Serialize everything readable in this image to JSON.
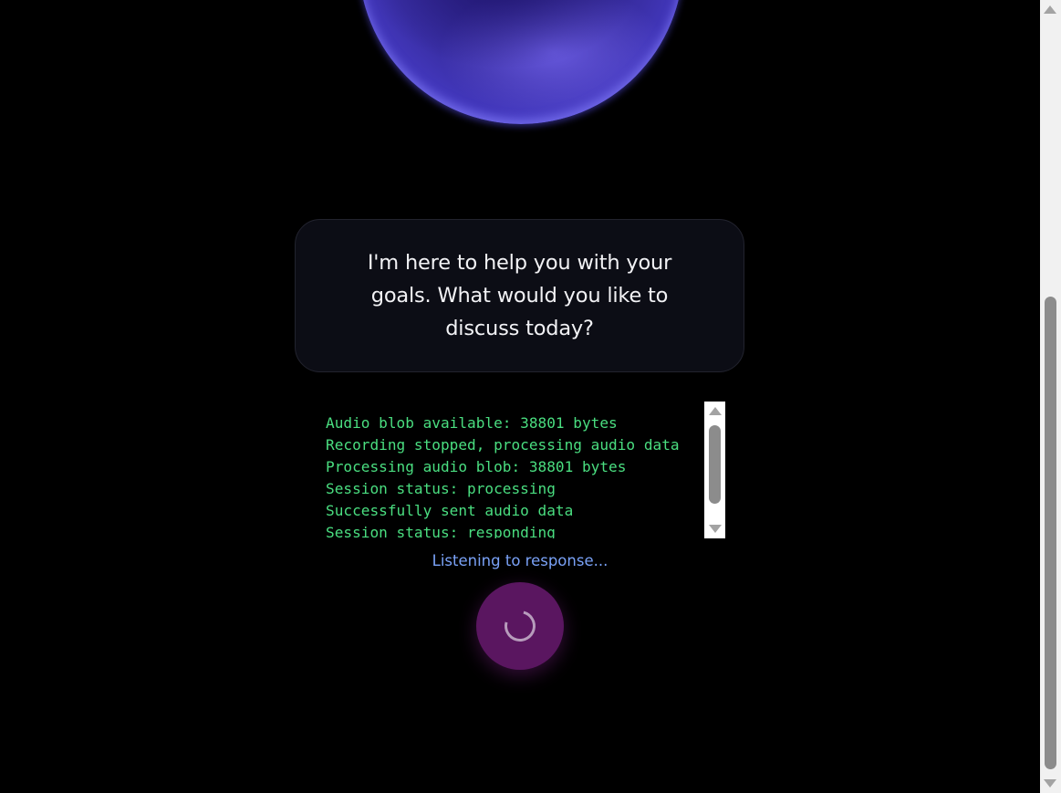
{
  "assistant": {
    "message": "I'm here to help you with your goals. What would you like to discuss today?"
  },
  "debug_log": {
    "lines": [
      "Audio blob available: 38801 bytes",
      "Recording stopped, processing audio data",
      "Processing audio blob: 38801 bytes",
      "Session status: processing",
      "Successfully sent audio data",
      "Session status: responding"
    ]
  },
  "status": {
    "text": "Listening to response..."
  },
  "mic_button": {
    "icon": "loading-spinner-icon",
    "accent_color": "#5a1660"
  },
  "theme": {
    "background": "#000000",
    "orb_color": "#4a3fd0",
    "log_text_color": "#4ade80",
    "status_text_color": "#7aa2f7"
  }
}
